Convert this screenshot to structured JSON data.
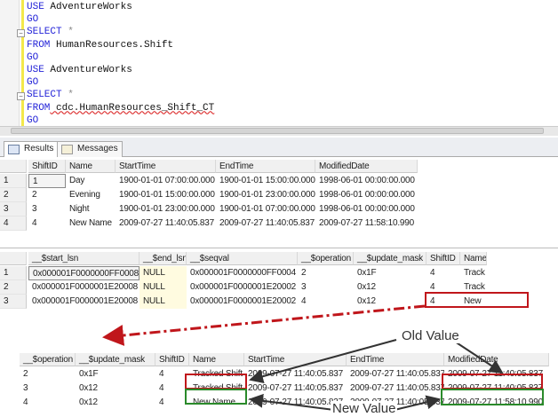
{
  "editor": {
    "lines": [
      [
        [
          "kw",
          "USE"
        ],
        [
          "tx",
          " AdventureWorks"
        ]
      ],
      [
        [
          "kw",
          "GO"
        ]
      ],
      [
        [
          "kw",
          "SELECT"
        ],
        [
          "op",
          " *"
        ]
      ],
      [
        [
          "kw",
          "FROM"
        ],
        [
          "tx",
          " HumanResources.Shift"
        ]
      ],
      [
        [
          "kw",
          "GO"
        ]
      ],
      [
        [
          "kw",
          "USE"
        ],
        [
          "tx",
          " AdventureWorks"
        ]
      ],
      [
        [
          "kw",
          "GO"
        ]
      ],
      [
        [
          "kw",
          "SELECT"
        ],
        [
          "op",
          " *"
        ]
      ],
      [
        [
          "kw",
          "FROM"
        ],
        [
          "sq",
          " cdc.HumanResources_Shift_CT"
        ]
      ],
      [
        [
          "kw",
          "GO"
        ]
      ]
    ]
  },
  "tabs": {
    "results": "Results",
    "messages": "Messages"
  },
  "grid1": {
    "headers": [
      "ShiftID",
      "Name",
      "StartTime",
      "EndTime",
      "ModifiedDate"
    ],
    "rows": [
      [
        "1",
        "1",
        "Day",
        "1900-01-01 07:00:00.000",
        "1900-01-01 15:00:00.000",
        "1998-06-01 00:00:00.000"
      ],
      [
        "2",
        "2",
        "Evening",
        "1900-01-01 15:00:00.000",
        "1900-01-01 23:00:00.000",
        "1998-06-01 00:00:00.000"
      ],
      [
        "3",
        "3",
        "Night",
        "1900-01-01 23:00:00.000",
        "1900-01-01 07:00:00.000",
        "1998-06-01 00:00:00.000"
      ],
      [
        "4",
        "4",
        "New Name",
        "2009-07-27 11:40:05.837",
        "2009-07-27 11:40:05.837",
        "2009-07-27 11:58:10.990"
      ]
    ]
  },
  "grid2": {
    "headers": [
      "__$start_lsn",
      "__$end_lsn",
      "__$seqval",
      "__$operation",
      "__$update_mask",
      "ShiftID",
      "Name"
    ],
    "rows": [
      [
        "1",
        "0x000001F0000000FF0008",
        "NULL",
        "0x000001F0000000FF0004",
        "2",
        "0x1F",
        "4",
        "Track"
      ],
      [
        "2",
        "0x000001F0000001E20008",
        "NULL",
        "0x000001F0000001E20002",
        "3",
        "0x12",
        "4",
        "Track"
      ],
      [
        "3",
        "0x000001F0000001E20008",
        "NULL",
        "0x000001F0000001E20002",
        "4",
        "0x12",
        "4",
        "New"
      ]
    ]
  },
  "grid3": {
    "headers": [
      "__$operation",
      "__$update_mask",
      "ShiftID",
      "Name",
      "StartTime",
      "EndTime",
      "ModifiedDate"
    ],
    "rows": [
      [
        "2",
        "0x1F",
        "4",
        "Tracked Shift",
        "2009-07-27 11:40:05.837",
        "2009-07-27 11:40:05.837",
        "2009-07-27 11:40:05.837"
      ],
      [
        "3",
        "0x12",
        "4",
        "Tracked Shift",
        "2009-07-27 11:40:05.837",
        "2009-07-27 11:40:05.837",
        "2009-07-27 11:40:05.837"
      ],
      [
        "4",
        "0x12",
        "4",
        "New Name",
        "2009-07-27 11:40:05.837",
        "2009-07-27 11:40:05.837",
        "2009-07-27 11:58:10.990"
      ]
    ]
  },
  "annotations": {
    "old_value": "Old Value",
    "new_value": "New Value"
  },
  "colors": {
    "keyword": "#2424d8",
    "old_box": "#c0161b",
    "new_box": "#2a8a2a"
  }
}
